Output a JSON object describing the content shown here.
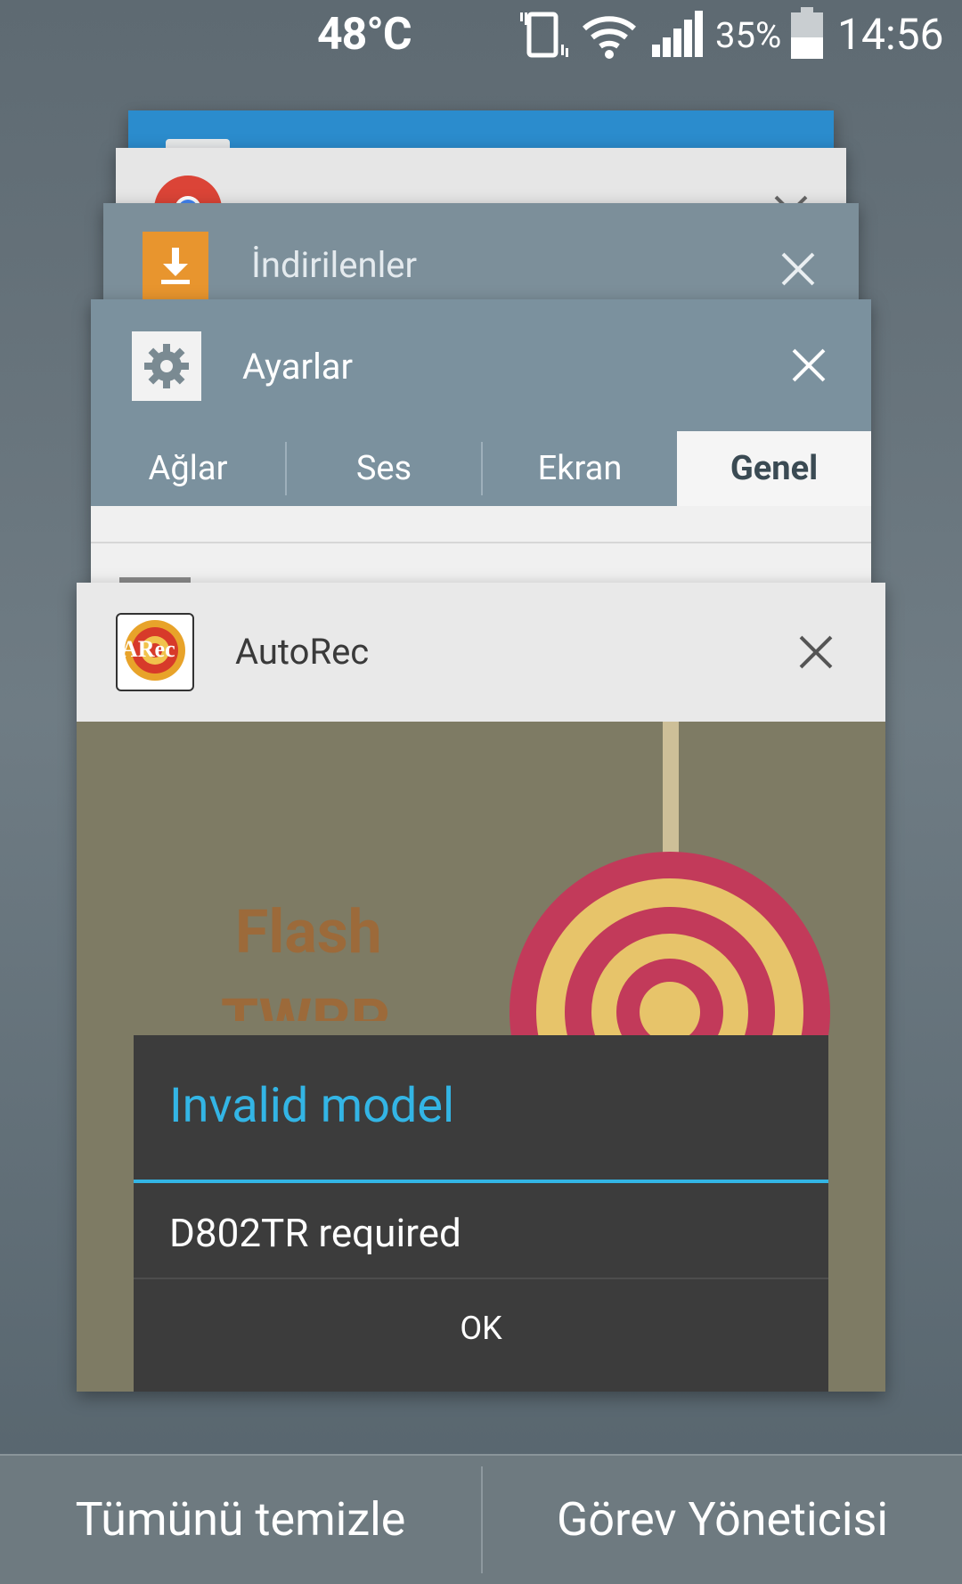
{
  "status_bar": {
    "temperature": "48°C",
    "battery_percent": "35%",
    "time": "14:56",
    "icons": [
      "vibrate-icon",
      "wifi-icon",
      "signal-icon",
      "battery-icon"
    ]
  },
  "recents": {
    "cards": [
      {
        "app": "Chrome",
        "title": "",
        "icon": "chrome-icon"
      },
      {
        "app": "Downloads",
        "title": "İndirilenler",
        "icon": "download-icon"
      },
      {
        "app": "Settings",
        "title": "Ayarlar",
        "icon": "gear-icon",
        "tabs": [
          "Ağlar",
          "Ses",
          "Ekran",
          "Genel"
        ],
        "active_tab": "Genel"
      },
      {
        "app": "AutoRec",
        "title": "AutoRec",
        "icon": "autorec-icon",
        "icon_text": "ARec",
        "background_text": [
          "Flash",
          "TWRP"
        ],
        "dialog": {
          "title": "Invalid model",
          "message": "D802TR required",
          "button": "OK"
        }
      }
    ]
  },
  "bottom_bar": {
    "clear_all": "Tümünü temizle",
    "task_manager": "Görev Yöneticisi"
  },
  "colors": {
    "accent": "#33b5e5",
    "settings_header": "#7b919e",
    "download_orange": "#e8952e",
    "dialog_bg": "#3c3c3c"
  }
}
